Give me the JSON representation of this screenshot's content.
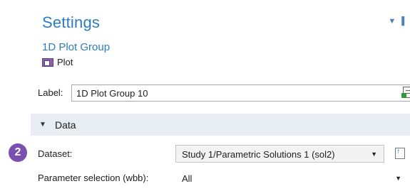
{
  "header": {
    "title": "Settings",
    "subtitle": "1D Plot Group",
    "plot_button_label": "Plot"
  },
  "label_field": {
    "label": "Label:",
    "value": "1D Plot Group 10"
  },
  "section": {
    "title": "Data",
    "expanded": true
  },
  "callout_badge": "2",
  "dataset": {
    "label": "Dataset:",
    "selected": "Study 1/Parametric Solutions 1 (sol2)"
  },
  "parameter_selection": {
    "label": "Parameter selection (wbb):",
    "selected": "All"
  },
  "colors": {
    "accent": "#2e7cc0",
    "section_bg": "#e8edf3",
    "badge": "#7a4fb0"
  }
}
